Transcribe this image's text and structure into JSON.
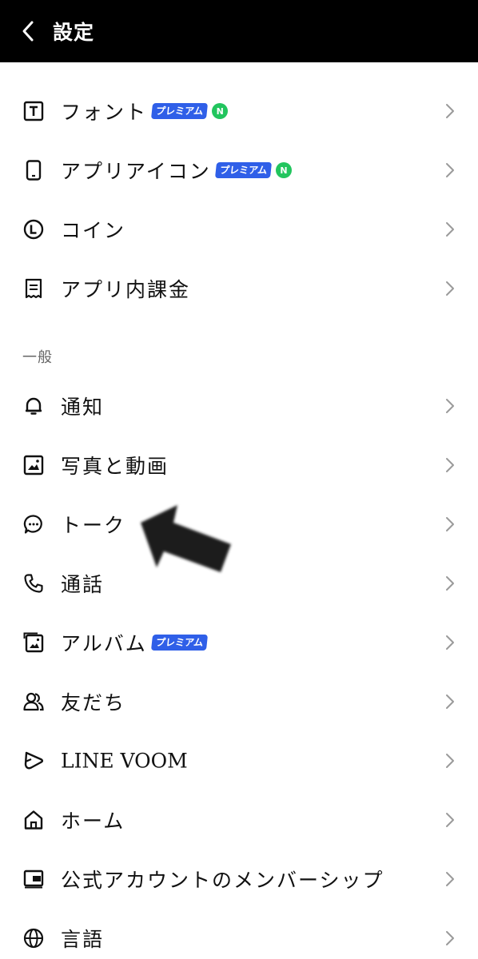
{
  "header": {
    "title": "設定"
  },
  "top_items": [
    {
      "label": "フォント",
      "icon": "font-icon",
      "premium": true,
      "new": true
    },
    {
      "label": "アプリアイコン",
      "icon": "phone-icon",
      "premium": true,
      "new": true
    },
    {
      "label": "コイン",
      "icon": "coin-icon",
      "premium": false,
      "new": false
    },
    {
      "label": "アプリ内課金",
      "icon": "receipt-icon",
      "premium": false,
      "new": false
    }
  ],
  "badges": {
    "premium": "プレミアム",
    "new": "N"
  },
  "section_general": "一般",
  "general_items": [
    {
      "label": "通知",
      "icon": "bell-icon"
    },
    {
      "label": "写真と動画",
      "icon": "photo-icon"
    },
    {
      "label": "トーク",
      "icon": "chat-bubble-icon"
    },
    {
      "label": "通話",
      "icon": "phone-call-icon"
    },
    {
      "label": "アルバム",
      "icon": "album-icon",
      "premium": true
    },
    {
      "label": "友だち",
      "icon": "friends-icon"
    },
    {
      "label": "LINE VOOM",
      "icon": "voom-icon"
    },
    {
      "label": "ホーム",
      "icon": "home-icon"
    },
    {
      "label": "公式アカウントのメンバーシップ",
      "icon": "membership-icon"
    },
    {
      "label": "言語",
      "icon": "globe-icon"
    }
  ],
  "colors": {
    "header_bg": "#000000",
    "premium_badge": "#2f5fe8",
    "new_badge": "#22c55e",
    "annotation_arrow": "#1f1f1f"
  }
}
